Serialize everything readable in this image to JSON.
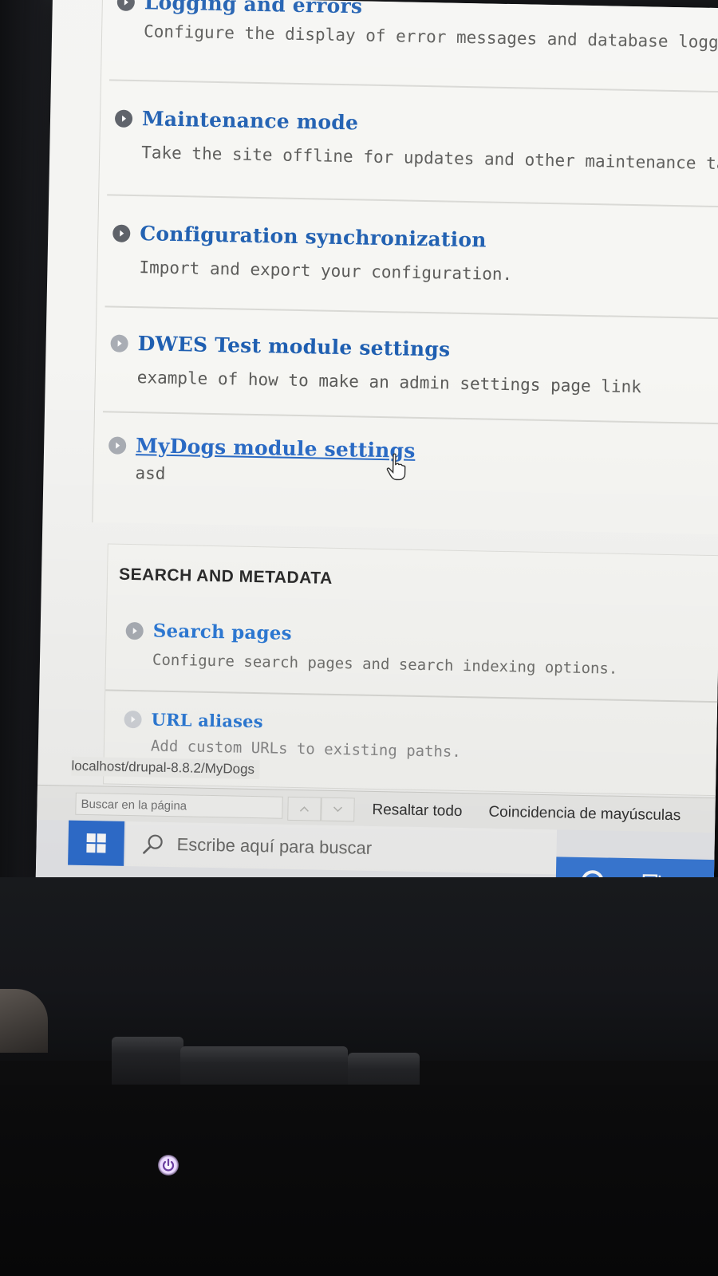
{
  "admin_items": [
    {
      "title": "Logging and errors",
      "description": "Configure the display of error messages and database loggi"
    },
    {
      "title": "Maintenance mode",
      "description": "Take the site offline for updates and other maintenance task"
    },
    {
      "title": "Configuration synchronization",
      "description": "Import and export your configuration."
    },
    {
      "title": "DWES Test module settings",
      "description": "example of how to make an admin settings page link"
    },
    {
      "title": "MyDogs module settings",
      "description": "asd"
    }
  ],
  "search_section": {
    "heading": "SEARCH AND METADATA",
    "items": [
      {
        "title": "Search pages",
        "description": "Configure search pages and search indexing options."
      },
      {
        "title": "URL aliases",
        "description": "Add custom URLs to existing paths."
      }
    ]
  },
  "status_bar": {
    "url": "localhost/drupal-8.8.2/MyDogs"
  },
  "find_bar": {
    "placeholder": "Buscar en la página",
    "highlight_all": "Resaltar todo",
    "match_case": "Coincidencia de mayúsculas"
  },
  "taskbar": {
    "search_placeholder": "Escribe aquí para buscar"
  },
  "colors": {
    "link": "#1f5fb1",
    "taskbar_accent": "#2f6fd0",
    "power_led": "#e9d6ff"
  },
  "icons": [
    "bullet-arrow-icon",
    "hand-cursor-icon",
    "windows-logo-icon",
    "magnifier-icon",
    "cortana-icon",
    "task-view-icon",
    "power-icon"
  ]
}
